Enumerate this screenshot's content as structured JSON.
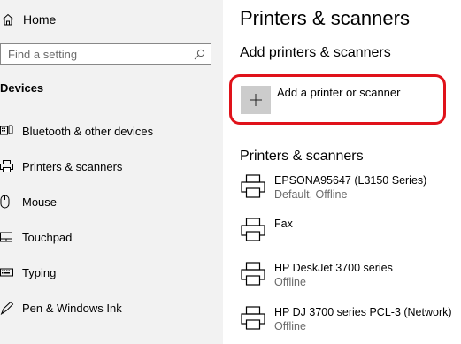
{
  "sidebar": {
    "home_label": "Home",
    "search_placeholder": "Find a setting",
    "section_title": "Devices",
    "items": [
      {
        "label": "Bluetooth & other devices",
        "icon": "bluetooth-devices-icon"
      },
      {
        "label": "Printers & scanners",
        "icon": "printer-icon"
      },
      {
        "label": "Mouse",
        "icon": "mouse-icon"
      },
      {
        "label": "Touchpad",
        "icon": "touchpad-icon"
      },
      {
        "label": "Typing",
        "icon": "keyboard-icon"
      },
      {
        "label": "Pen & Windows Ink",
        "icon": "pen-icon"
      }
    ]
  },
  "main": {
    "title": "Printers & scanners",
    "add_section_title": "Add printers & scanners",
    "add_label": "Add a printer or scanner",
    "list_title": "Printers & scanners",
    "printers": [
      {
        "name": "EPSONA95647 (L3150 Series)",
        "status": "Default, Offline"
      },
      {
        "name": "Fax",
        "status": ""
      },
      {
        "name": "HP DeskJet 3700 series",
        "status": "Offline"
      },
      {
        "name": "HP DJ 3700 series PCL-3 (Network)",
        "status": "Offline"
      }
    ]
  },
  "colors": {
    "sidebar_bg": "#f2f2f2",
    "highlight": "#e0121a",
    "add_button_bg": "#cccccc",
    "secondary_text": "#6b6b6b"
  }
}
